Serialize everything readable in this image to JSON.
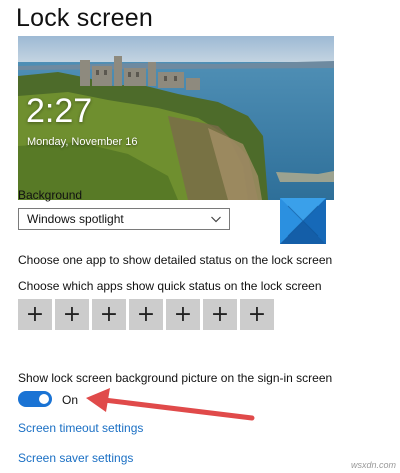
{
  "header": {
    "title": "Lock screen"
  },
  "preview": {
    "time": "2:27",
    "date": "Monday, November 16"
  },
  "background": {
    "label": "Background",
    "selected": "Windows spotlight"
  },
  "detailed_status": {
    "label": "Choose one app to show detailed status on the lock screen"
  },
  "quick_status": {
    "label": "Choose which apps show quick status on the lock screen",
    "slots": [
      "+",
      "+",
      "+",
      "+",
      "+",
      "+",
      "+"
    ]
  },
  "signin_picture": {
    "label": "Show lock screen background picture on the sign-in screen",
    "toggle_state": "On"
  },
  "links": {
    "screen_timeout": "Screen timeout settings",
    "screen_saver": "Screen saver settings"
  },
  "watermark": "wsxdn.com",
  "colors": {
    "accent": "#1a73d4",
    "link": "#1a6fc4",
    "arrow": "#e04a4a",
    "slot": "#cccccc"
  },
  "icons": [
    "chevron-down-icon",
    "windows-logo-icon",
    "plus-icon"
  ]
}
